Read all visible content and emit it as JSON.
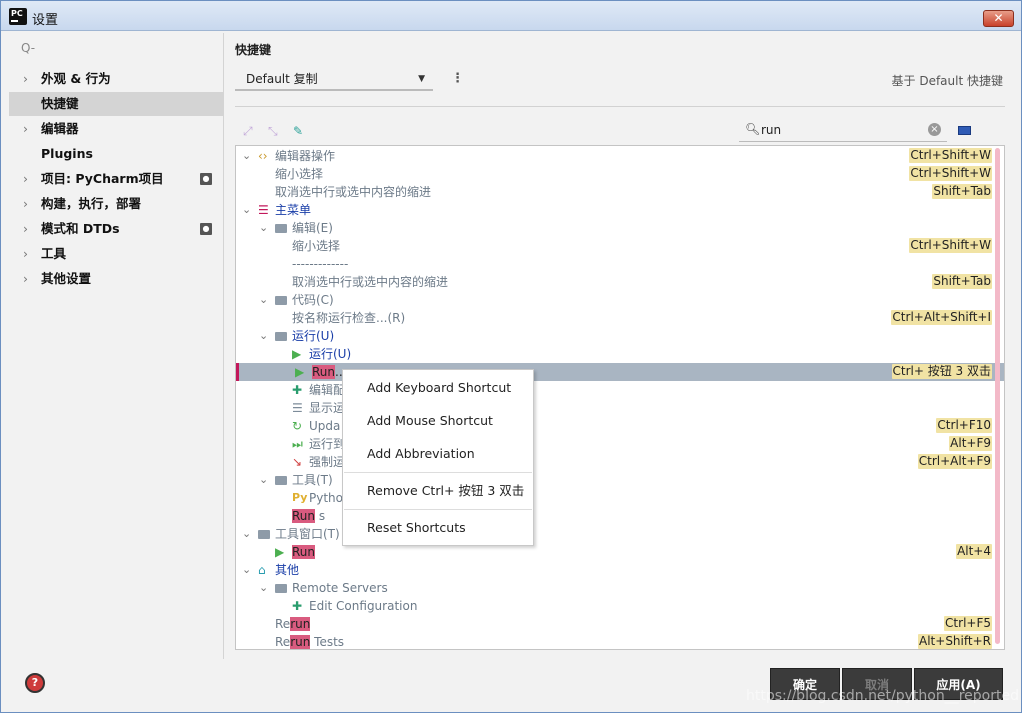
{
  "window": {
    "title": "设置",
    "app_icon": "PC",
    "close": "✕"
  },
  "sidebar": {
    "search_placeholder": "Q-",
    "items": [
      {
        "label": "外观 & 行为",
        "expandable": true
      },
      {
        "label": "快捷键",
        "expandable": false,
        "selected": true
      },
      {
        "label": "编辑器",
        "expandable": true
      },
      {
        "label": "Plugins",
        "expandable": false
      },
      {
        "label": "项目: PyCharm项目",
        "expandable": true,
        "badge": true
      },
      {
        "label": "构建，执行，部署",
        "expandable": true
      },
      {
        "label": "模式和 DTDs",
        "expandable": true,
        "badge": true
      },
      {
        "label": "工具",
        "expandable": true
      },
      {
        "label": "其他设置",
        "expandable": true
      }
    ]
  },
  "main": {
    "heading": "快捷键",
    "keymap_value": "Default 复制",
    "based_on": "基于 Default 快捷键",
    "search_value": "run"
  },
  "tree": [
    {
      "indent": 0,
      "toggle": "v",
      "icon": "code",
      "text": "编辑器操作",
      "color": "gray",
      "shortcut": "Ctrl+Shift+W"
    },
    {
      "indent": 1,
      "text": "缩小选择",
      "color": "gray",
      "shortcut": "Ctrl+Shift+W"
    },
    {
      "indent": 1,
      "text": "取消选中行或选中内容的缩进",
      "color": "gray",
      "shortcut": "Shift+Tab"
    },
    {
      "indent": 0,
      "toggle": "v",
      "icon": "menu",
      "text": "主菜单",
      "color": "blue"
    },
    {
      "indent": 1,
      "toggle": "v",
      "icon": "folder",
      "text": "编辑(E)",
      "color": "gray"
    },
    {
      "indent": 2,
      "text": "缩小选择",
      "color": "gray",
      "shortcut": "Ctrl+Shift+W"
    },
    {
      "indent": 2,
      "text": "-------------",
      "color": "gray"
    },
    {
      "indent": 2,
      "text": "取消选中行或选中内容的缩进",
      "color": "gray",
      "shortcut": "Shift+Tab"
    },
    {
      "indent": 1,
      "toggle": "v",
      "icon": "folder",
      "text": "代码(C)",
      "color": "gray"
    },
    {
      "indent": 2,
      "text": "按名称运行检查...(R)",
      "color": "gray",
      "shortcut": "Ctrl+Alt+Shift+I"
    },
    {
      "indent": 1,
      "toggle": "v",
      "icon": "folder",
      "text": "运行(U)",
      "color": "blue"
    },
    {
      "indent": 2,
      "icon": "play",
      "text": "运行(U)",
      "color": "blue"
    },
    {
      "indent": 2,
      "icon": "play",
      "pre": "",
      "hl": "Run",
      "post": "...",
      "color": "dark",
      "shortcut": "Ctrl+ 按钮 3 双击",
      "selected": true
    },
    {
      "indent": 2,
      "icon": "edit-config",
      "text": "编辑配",
      "color": "gray"
    },
    {
      "indent": 2,
      "icon": "list",
      "text": "显示运",
      "color": "gray"
    },
    {
      "indent": 2,
      "icon": "refresh",
      "text": "Upda",
      "color": "gray",
      "shortcut": "Ctrl+F10"
    },
    {
      "indent": 2,
      "icon": "fast-forward",
      "text": "运行到",
      "color": "gray",
      "shortcut": "Alt+F9"
    },
    {
      "indent": 2,
      "icon": "step",
      "text": "强制运",
      "color": "gray",
      "shortcut": "Ctrl+Alt+F9"
    },
    {
      "indent": 1,
      "toggle": "v",
      "icon": "folder",
      "text": "工具(T)",
      "color": "gray"
    },
    {
      "indent": 2,
      "icon": "python",
      "text": "Pytho",
      "color": "gray"
    },
    {
      "indent": 2,
      "pre": "",
      "hl": "Run",
      "post": " s",
      "color": "gray"
    },
    {
      "indent": 0,
      "toggle": "v",
      "icon": "folder",
      "text": "工具窗口(T)",
      "color": "gray"
    },
    {
      "indent": 1,
      "icon": "run-window",
      "pre": "",
      "hl": "Run",
      "post": "",
      "color": "gray",
      "shortcut": "Alt+4"
    },
    {
      "indent": 0,
      "toggle": "v",
      "icon": "other",
      "text": "其他",
      "color": "blue"
    },
    {
      "indent": 1,
      "toggle": "v",
      "icon": "folder",
      "text": "Remote Servers",
      "color": "gray"
    },
    {
      "indent": 2,
      "icon": "edit-config",
      "text": "Edit Configuration",
      "color": "gray"
    },
    {
      "indent": 1,
      "pre": "Re",
      "hl": "run",
      "post": "",
      "color": "gray",
      "shortcut": "Ctrl+F5"
    },
    {
      "indent": 1,
      "pre": "Re",
      "hl": "run",
      "post": " Tests",
      "color": "gray",
      "shortcut": "Alt+Shift+R"
    }
  ],
  "context_menu": [
    "Add Keyboard Shortcut",
    "Add Mouse Shortcut",
    "Add Abbreviation",
    "Remove Ctrl+ 按钮 3 双击",
    "Reset Shortcuts"
  ],
  "buttons": {
    "ok": "确定",
    "cancel": "取消",
    "apply": "应用(A)"
  },
  "help": "?",
  "watermark": "https://blog.csdn.net/python__reported",
  "colors": {
    "highlight": "#d95b7f",
    "shortcut_bg": "#f1e3a4",
    "selection": "#a9b5c2",
    "blue_text": "#1a3ea8"
  }
}
